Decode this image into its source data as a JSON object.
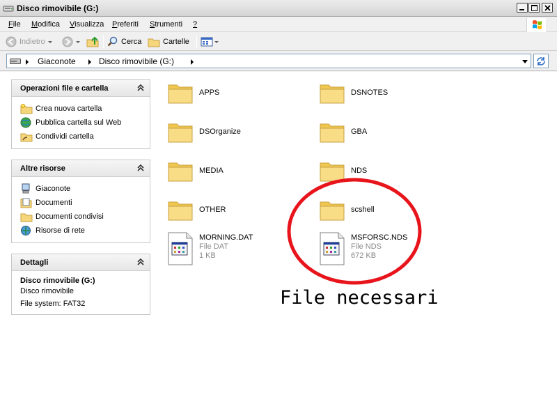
{
  "window": {
    "title": "Disco rimovibile (G:)"
  },
  "menu": [
    {
      "label": "File",
      "ul": "F",
      "rest": "ile"
    },
    {
      "label": "Modifica",
      "ul": "M",
      "rest": "odifica"
    },
    {
      "label": "Visualizza",
      "ul": "V",
      "rest": "isualizza"
    },
    {
      "label": "Preferiti",
      "ul": "P",
      "rest": "referiti"
    },
    {
      "label": "Strumenti",
      "ul": "S",
      "rest": "trumenti"
    },
    {
      "label": "?",
      "ul": "?",
      "rest": ""
    }
  ],
  "toolbar": {
    "back_label": "Indietro",
    "search_label": "Cerca",
    "folders_label": "Cartelle"
  },
  "address": {
    "crumbs": [
      "Giaconote",
      "Disco rimovibile (G:)"
    ]
  },
  "sidebar": {
    "tasks": {
      "title": "Operazioni file e cartella",
      "items": [
        {
          "label": "Crea nuova cartella",
          "icon": "new-folder-icon"
        },
        {
          "label": "Pubblica cartella sul Web",
          "icon": "globe-icon"
        },
        {
          "label": "Condividi cartella",
          "icon": "share-folder-icon"
        }
      ]
    },
    "other": {
      "title": "Altre risorse",
      "items": [
        {
          "label": "Giaconote",
          "icon": "computer-icon"
        },
        {
          "label": "Documenti",
          "icon": "documents-icon"
        },
        {
          "label": "Documenti condivisi",
          "icon": "shared-folder-icon"
        },
        {
          "label": "Risorse di rete",
          "icon": "network-icon"
        }
      ]
    },
    "details": {
      "title": "Dettagli",
      "name": "Disco rimovibile (G:)",
      "type": "Disco rimovibile",
      "fs": "File system: FAT32"
    }
  },
  "files": [
    {
      "name": "APPS",
      "kind": "folder"
    },
    {
      "name": "DSNOTES",
      "kind": "folder"
    },
    {
      "name": "DSOrganize",
      "kind": "folder"
    },
    {
      "name": "GBA",
      "kind": "folder"
    },
    {
      "name": "MEDIA",
      "kind": "folder"
    },
    {
      "name": "NDS",
      "kind": "folder"
    },
    {
      "name": "OTHER",
      "kind": "folder"
    },
    {
      "name": "scshell",
      "kind": "folder"
    },
    {
      "name": "MORNING.DAT",
      "kind": "file",
      "type": "File DAT",
      "size": "1 KB"
    },
    {
      "name": "MSFORSC.NDS",
      "kind": "file",
      "type": "File NDS",
      "size": "672 KB"
    }
  ],
  "annotation": {
    "text": "File necessari",
    "color": "#e8141b"
  },
  "colors": {
    "folder": "#f5d67a",
    "accent_red": "#e8141b"
  }
}
